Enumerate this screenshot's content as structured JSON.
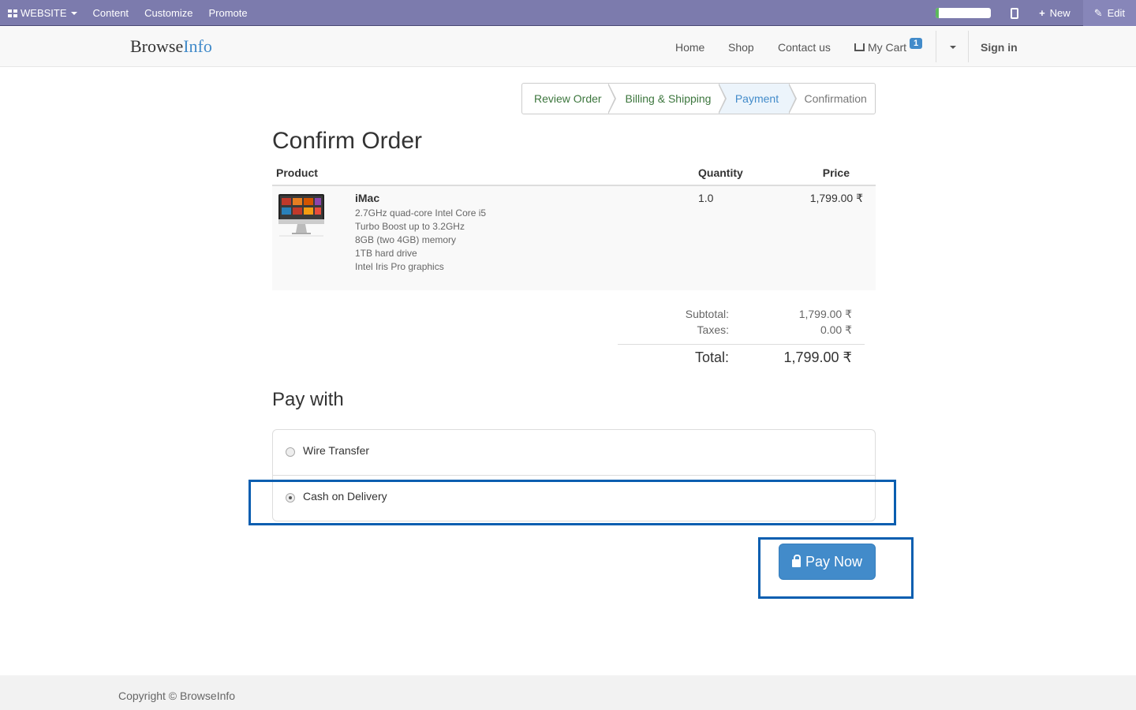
{
  "adminbar": {
    "website_label": "WEBSITE",
    "content_label": "Content",
    "customize_label": "Customize",
    "promote_label": "Promote",
    "new_label": "New",
    "edit_label": "Edit",
    "progress_fraction": 0.05
  },
  "navbar": {
    "brand_part1": "Browse",
    "brand_part2": "Info",
    "home": "Home",
    "shop": "Shop",
    "contact": "Contact us",
    "cart": "My Cart",
    "cart_count": "1",
    "signin": "Sign in"
  },
  "wizard": {
    "steps": [
      "Review Order",
      "Billing & Shipping",
      "Payment",
      "Confirmation"
    ]
  },
  "order": {
    "title": "Confirm Order",
    "headers": {
      "product": "Product",
      "quantity": "Quantity",
      "price": "Price"
    },
    "item": {
      "name": "iMac",
      "desc": [
        "2.7GHz quad-core Intel Core i5",
        "Turbo Boost up to 3.2GHz",
        "8GB (two 4GB) memory",
        "1TB hard drive",
        "Intel Iris Pro graphics"
      ],
      "quantity": "1.0",
      "price": "1,799.00 ₹"
    },
    "subtotal_label": "Subtotal:",
    "subtotal": "1,799.00 ₹",
    "taxes_label": "Taxes:",
    "taxes": "0.00 ₹",
    "total_label": "Total:",
    "total": "1,799.00 ₹"
  },
  "payment": {
    "title": "Pay with",
    "options": [
      "Wire Transfer",
      "Cash on Delivery"
    ],
    "selected": "Cash on Delivery",
    "button": "Pay Now"
  },
  "footer": {
    "copyright": "Copyright © BrowseInfo"
  }
}
